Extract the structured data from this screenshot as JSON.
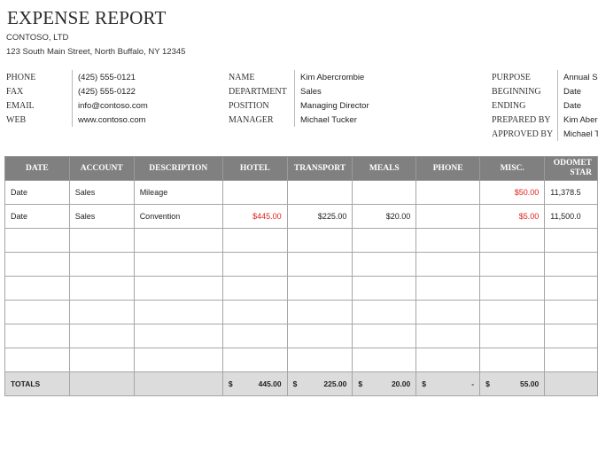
{
  "header": {
    "title": "EXPENSE REPORT",
    "company": "CONTOSO, LTD",
    "address": "123 South Main Street, North Buffalo, NY 12345"
  },
  "contact": [
    {
      "label": "PHONE",
      "value": "(425) 555-0121"
    },
    {
      "label": "FAX",
      "value": "(425) 555-0122"
    },
    {
      "label": "EMAIL",
      "value": "info@contoso.com"
    },
    {
      "label": "WEB",
      "value": "www.contoso.com"
    }
  ],
  "employee": [
    {
      "label": "NAME",
      "value": "Kim Abercrombie"
    },
    {
      "label": "DEPARTMENT",
      "value": "Sales"
    },
    {
      "label": "POSITION",
      "value": "Managing Director"
    },
    {
      "label": "MANAGER",
      "value": "Michael Tucker"
    }
  ],
  "report": [
    {
      "label": "PURPOSE",
      "value": "Annual Sa"
    },
    {
      "label": "BEGINNING",
      "value": "Date"
    },
    {
      "label": "ENDING",
      "value": "Date"
    },
    {
      "label": "PREPARED BY",
      "value": "Kim Aberc"
    },
    {
      "label": "APPROVED BY",
      "value": "Michael T"
    }
  ],
  "table": {
    "columns": [
      "DATE",
      "ACCOUNT",
      "DESCRIPTION",
      "HOTEL",
      "TRANSPORT",
      "MEALS",
      "PHONE",
      "MISC.",
      "ODOMETER START"
    ],
    "odometer_line1": "ODOMET",
    "odometer_line2": "STAR",
    "rows": [
      {
        "date": "Date",
        "account": "Sales",
        "description": "Mileage",
        "hotel": "",
        "transport": "",
        "meals": "",
        "phone": "",
        "misc": "$50.00",
        "odometer": "11,378.5"
      },
      {
        "date": "Date",
        "account": "Sales",
        "description": "Convention",
        "hotel": "$445.00",
        "transport": "$225.00",
        "meals": "$20.00",
        "phone": "",
        "misc": "$5.00",
        "odometer": "11,500.0"
      }
    ],
    "empty_rows": 6,
    "totals": {
      "label": "TOTALS",
      "currency": "$",
      "hotel": "445.00",
      "transport": "225.00",
      "meals": "20.00",
      "phone": "-",
      "misc": "55.00"
    }
  },
  "colors": {
    "header_bg": "#808080",
    "totals_bg": "#dcdcdc",
    "negative_red": "#e0201b"
  }
}
